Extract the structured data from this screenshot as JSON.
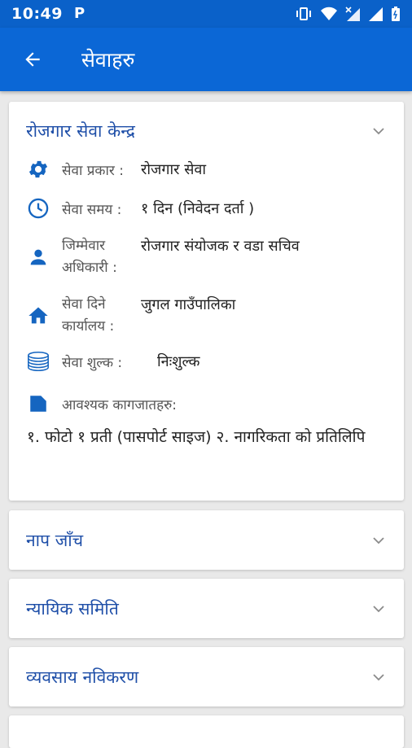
{
  "status_bar": {
    "time": "10:49",
    "app_badge": "P"
  },
  "app_bar": {
    "title": "सेवाहरु"
  },
  "sections": [
    {
      "title": "रोजगार सेवा केन्द्र",
      "expanded": true,
      "rows": [
        {
          "icon": "gear-icon",
          "label": "सेवा प्रकार :",
          "value": "रोजगार सेवा"
        },
        {
          "icon": "clock-icon",
          "label": "सेवा समय :",
          "value": "१ दिन (निवेदन दर्ता )"
        },
        {
          "icon": "person-icon",
          "label_line1": "जिम्मेवार",
          "label_line2": "अधिकारी :",
          "value": "रोजगार संयोजक र वडा सचिव"
        },
        {
          "icon": "home-icon",
          "label_line1": "सेवा दिने",
          "label_line2": "कार्यालय :",
          "value": "जुगल गाउँपालिका"
        },
        {
          "icon": "coins-icon",
          "label": "सेवा शुल्क :",
          "value": "निःशुल्क"
        },
        {
          "icon": "document-icon",
          "label": "आवश्यक कागजातहरु:"
        }
      ],
      "documents": "१. फोटो १ प्रती (पासपोर्ट साइज) २. नागरिकता को प्रतिलिपि"
    },
    {
      "title": "नाप जाँच",
      "expanded": false
    },
    {
      "title": "न्यायिक समिति",
      "expanded": false
    },
    {
      "title": "व्यवसाय नविकरण",
      "expanded": false
    }
  ],
  "colors": {
    "primary": "#0b67d6",
    "status_bar": "#0a61c9",
    "section_title": "#1f4fa8",
    "icon": "#1565c0"
  }
}
